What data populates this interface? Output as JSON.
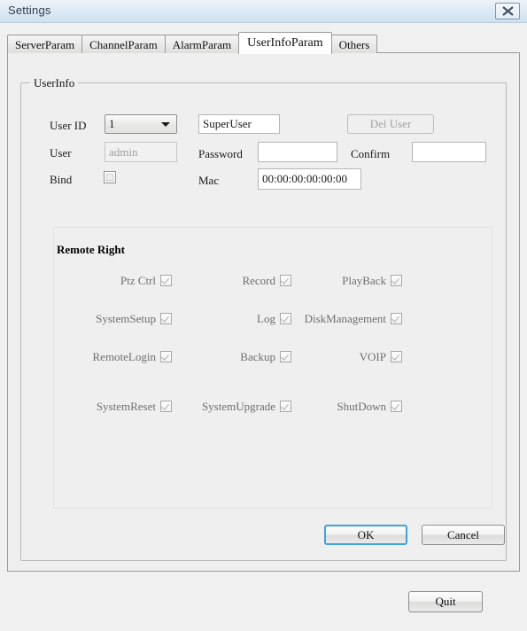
{
  "window": {
    "title": "Settings",
    "close_icon": "close-icon"
  },
  "tabs": [
    {
      "label": "ServerParam",
      "active": false
    },
    {
      "label": "ChannelParam",
      "active": false
    },
    {
      "label": "AlarmParam",
      "active": false
    },
    {
      "label": "UserInfoParam",
      "active": true
    },
    {
      "label": "Others",
      "active": false
    }
  ],
  "user_info": {
    "group_title": "UserInfo",
    "user_id_label": "User ID",
    "user_id_value": "1",
    "user_id_options": [
      "1"
    ],
    "group_name_value": "SuperUser",
    "del_user_label": "Del User",
    "del_user_enabled": false,
    "user_label": "User",
    "user_value": "admin",
    "user_enabled": false,
    "password_label": "Password",
    "password_value": "",
    "confirm_label": "Confirm",
    "confirm_value": "",
    "bind_label": "Bind",
    "bind_checked": false,
    "mac_label": "Mac",
    "mac_value": "00:00:00:00:00:00"
  },
  "remote_right": {
    "title": "Remote Right",
    "items": [
      {
        "label": "Ptz Ctrl",
        "checked": true,
        "col": 0,
        "row": 0
      },
      {
        "label": "Record",
        "checked": true,
        "col": 1,
        "row": 0
      },
      {
        "label": "PlayBack",
        "checked": true,
        "col": 2,
        "row": 0
      },
      {
        "label": "SystemSetup",
        "checked": true,
        "col": 0,
        "row": 1
      },
      {
        "label": "Log",
        "checked": true,
        "col": 1,
        "row": 1
      },
      {
        "label": "DiskManagement",
        "checked": true,
        "col": 2,
        "row": 1
      },
      {
        "label": "RemoteLogin",
        "checked": true,
        "col": 0,
        "row": 2
      },
      {
        "label": "Backup",
        "checked": true,
        "col": 1,
        "row": 2
      },
      {
        "label": "VOIP",
        "checked": true,
        "col": 2,
        "row": 2
      },
      {
        "label": "SystemReset",
        "checked": true,
        "col": 0,
        "row": 3
      },
      {
        "label": "SystemUpgrade",
        "checked": true,
        "col": 1,
        "row": 3
      },
      {
        "label": "ShutDown",
        "checked": true,
        "col": 2,
        "row": 3
      }
    ]
  },
  "dialog_buttons": {
    "ok_label": "OK",
    "ok_focused": true,
    "cancel_label": "Cancel"
  },
  "footer": {
    "quit_label": "Quit"
  },
  "colors": {
    "focus_blue": "#3ea2e0",
    "window_bg": "#f0f0f0",
    "pane_bg": "#f0efef",
    "titlebar_top": "#eef3f8",
    "titlebar_bottom": "#cfe0f0"
  }
}
